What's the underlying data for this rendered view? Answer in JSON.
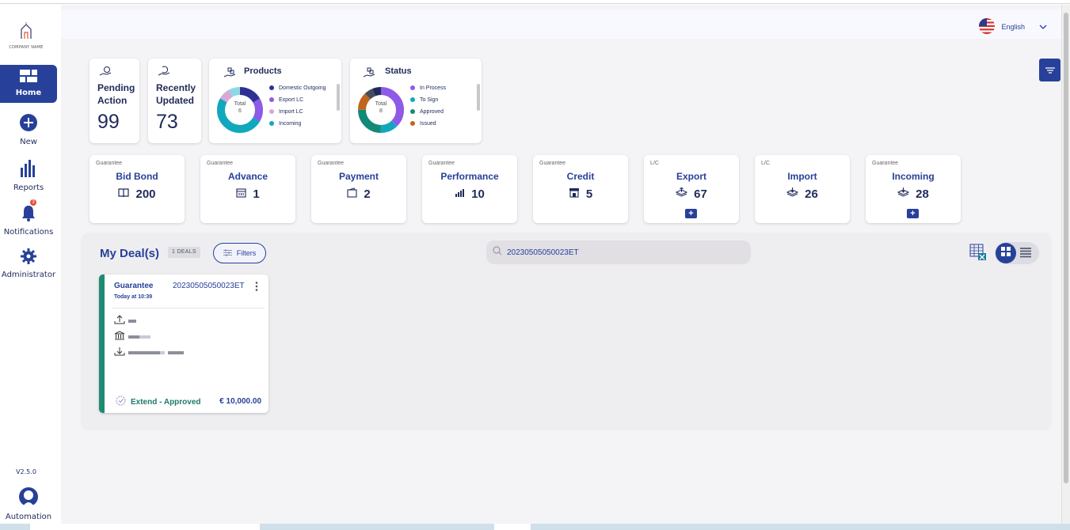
{
  "app": {
    "company_name": "COMPANY NAME",
    "version": "V2.5.0",
    "user_name": "Automation",
    "language": "English"
  },
  "sidebar": {
    "items": [
      {
        "label": "Home",
        "icon": "home-icon"
      },
      {
        "label": "New",
        "icon": "plus-circle-icon"
      },
      {
        "label": "Reports",
        "icon": "bar-chart-icon"
      },
      {
        "label": "Notifications",
        "icon": "bell-icon",
        "badge": "3"
      },
      {
        "label": "Administrator",
        "icon": "gear-icon"
      }
    ]
  },
  "summary": {
    "pending": {
      "title": "Pending Action",
      "value": "99"
    },
    "recent": {
      "title": "Recently Updated",
      "value": "73"
    }
  },
  "products_chart": {
    "title": "Products",
    "total_label": "Total",
    "total": "6",
    "legend": [
      {
        "label": "Domestic Outgoing",
        "color": "#2e3192"
      },
      {
        "label": "Export LC",
        "color": "#8e5ae8"
      },
      {
        "label": "Import LC",
        "color": "#d9a8d6"
      },
      {
        "label": "Incoming",
        "color": "#10a8bd"
      }
    ]
  },
  "status_chart": {
    "title": "Status",
    "total_label": "Total",
    "total": "8",
    "legend": [
      {
        "label": "In Process",
        "color": "#8e5ae8"
      },
      {
        "label": "To Sign",
        "color": "#10a8bd"
      },
      {
        "label": "Approved",
        "color": "#138a78"
      },
      {
        "label": "Issued",
        "color": "#c0651c"
      }
    ]
  },
  "products": [
    {
      "category": "Guarantee",
      "name": "Bid Bond",
      "count": "200",
      "icon": "book-icon",
      "has_add": false
    },
    {
      "category": "Guarantee",
      "name": "Advance",
      "count": "1",
      "icon": "calendar-icon",
      "has_add": false
    },
    {
      "category": "Guarantee",
      "name": "Payment",
      "count": "2",
      "icon": "wallet-icon",
      "has_add": false
    },
    {
      "category": "Guarantee",
      "name": "Performance",
      "count": "10",
      "icon": "growth-chart-icon",
      "has_add": false
    },
    {
      "category": "Guarantee",
      "name": "Credit",
      "count": "5",
      "icon": "store-icon",
      "has_add": false
    },
    {
      "category": "L/C",
      "name": "Export",
      "count": "67",
      "icon": "stack-up-icon",
      "has_add": true
    },
    {
      "category": "L/C",
      "name": "Import",
      "count": "26",
      "icon": "stack-down-icon",
      "has_add": false
    },
    {
      "category": "Guarantee",
      "name": "Incoming",
      "count": "28",
      "icon": "stack-down-icon",
      "has_add": true
    }
  ],
  "deals": {
    "title": "My Deal(s)",
    "count_badge": "1 DEALS",
    "filters_label": "Filters",
    "search_value": "20230505050023ET",
    "items": [
      {
        "type": "Guarantee",
        "reference": "20230505050023ET",
        "time": "Today at 10:39",
        "status": "Extend - Approved",
        "amount": "€ 10,000.00"
      }
    ]
  }
}
